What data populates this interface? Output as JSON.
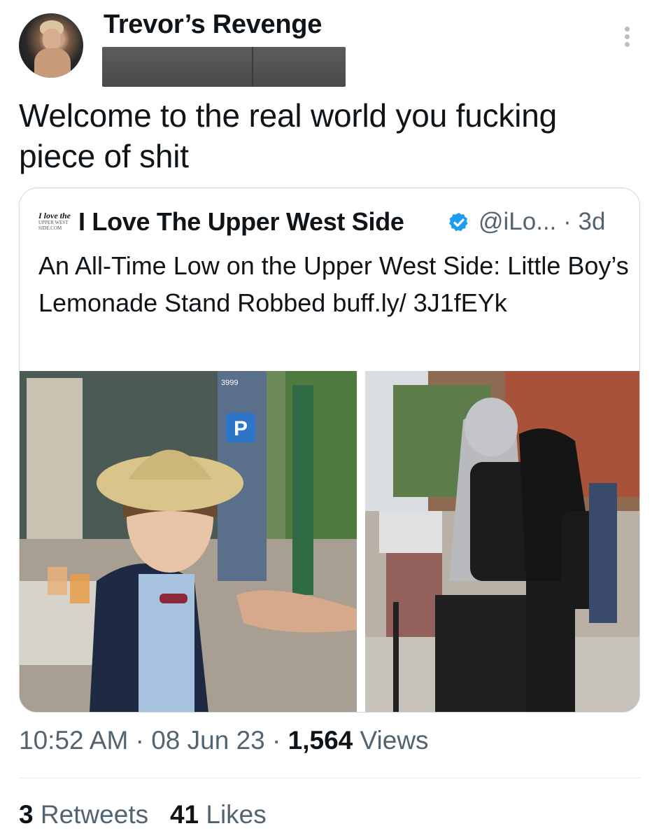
{
  "author": {
    "display_name": "Trevor’s Revenge",
    "avatar_icon": "avatar"
  },
  "tweet": {
    "text": "Welcome to the real world you fucking piece of shit",
    "time": "10:52 AM",
    "date": "08 Jun 23",
    "views_count": "1,564",
    "views_label": "Views",
    "retweets_count": "3",
    "retweets_label": "Retweets",
    "likes_count": "41",
    "likes_label": "Likes"
  },
  "quoted": {
    "logo_line1": "I love the",
    "logo_line2": "UPPER WEST SIDE.COM",
    "name": "I Love The Upper West Side",
    "handle": "@iLo...",
    "age": "3d",
    "text": "An All-Time Low on the Upper West Side: Little Boy’s Lemonade Stand Robbed buff.ly/ 3J1fEYk",
    "photo_sign_text": "3999",
    "photo_sign_letter": "P"
  },
  "colors": {
    "text_primary": "#0f1419",
    "text_secondary": "#536471",
    "verified_blue": "#1d9bf0",
    "border": "#cfd9de"
  }
}
